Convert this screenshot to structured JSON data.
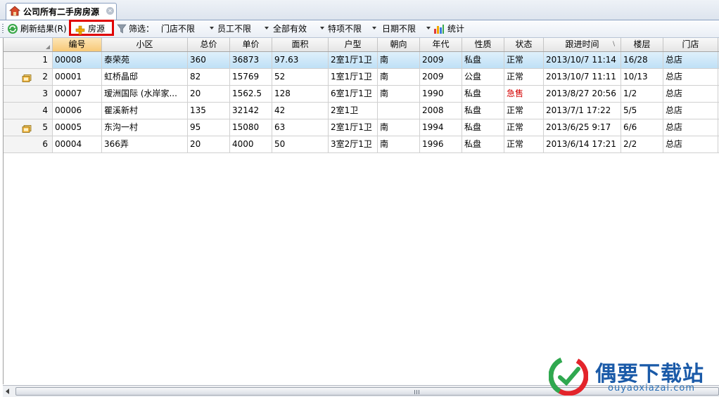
{
  "tab": {
    "title": "公司所有二手房房源"
  },
  "toolbar": {
    "refresh_label": "刷新结果(R)",
    "add_label": "房源",
    "filter_label": "筛选：",
    "filters": [
      "门店不限",
      "员工不限",
      "全部有效",
      "特项不限",
      "日期不限"
    ],
    "stats_label": "统计"
  },
  "table": {
    "columns": [
      "编号",
      "小区",
      "总价",
      "单价",
      "面积",
      "户型",
      "朝向",
      "年代",
      "性质",
      "状态",
      "跟进时间",
      "楼层",
      "门店"
    ],
    "sorted_column": "编号",
    "rows": [
      [
        "00008",
        "泰荣苑",
        "360",
        "36873",
        "97.63",
        "2室1厅1卫",
        "南",
        "2009",
        "私盘",
        "正常",
        "2013/10/7 11:14",
        "16/28",
        "总店"
      ],
      [
        "00001",
        "虹桥晶邸",
        "82",
        "15769",
        "52",
        "1室1厅1卫",
        "南",
        "2009",
        "公盘",
        "正常",
        "2013/10/7 11:11",
        "10/13",
        "总店"
      ],
      [
        "00007",
        "瑷洲国际 (水岸家...",
        "20",
        "1562.5",
        "128",
        "6室1厅1卫",
        "南",
        "1990",
        "私盘",
        "急售",
        "2013/8/27 20:56",
        "1/2",
        "总店"
      ],
      [
        "00006",
        "瞿溪新村",
        "135",
        "32142",
        "42",
        "2室1卫",
        "",
        "2008",
        "私盘",
        "正常",
        "2013/7/1 17:22",
        "5/5",
        "总店"
      ],
      [
        "00005",
        "东沟一村",
        "95",
        "15080",
        "63",
        "2室1厅1卫",
        "南",
        "1994",
        "私盘",
        "正常",
        "2013/6/25 9:17",
        "6/6",
        "总店"
      ],
      [
        "00004",
        "366弄",
        "20",
        "4000",
        "50",
        "3室2厅1卫",
        "南",
        "1996",
        "私盘",
        "正常",
        "2013/6/14 17:21",
        "2/2",
        "总店"
      ]
    ],
    "row_numbers": [
      "1",
      "2",
      "3",
      "4",
      "5",
      "6"
    ],
    "selected_row": 0,
    "has_photo_rows": [
      1,
      4
    ],
    "urgent_status": "急售"
  },
  "colors": {
    "highlight_border": "#e00000",
    "urgent_text": "#d40000",
    "selected_row": "#cde8f8"
  },
  "icons": [
    "home-icon",
    "close-icon",
    "refresh-icon",
    "plus-icon",
    "filter-icon",
    "dropdown-arrow-icon",
    "bar-chart-icon",
    "photo-icon",
    "sort-indicator-icon"
  ],
  "watermark": {
    "brand": "偶要下载站",
    "domain": "ouyaoxiazai.com"
  }
}
